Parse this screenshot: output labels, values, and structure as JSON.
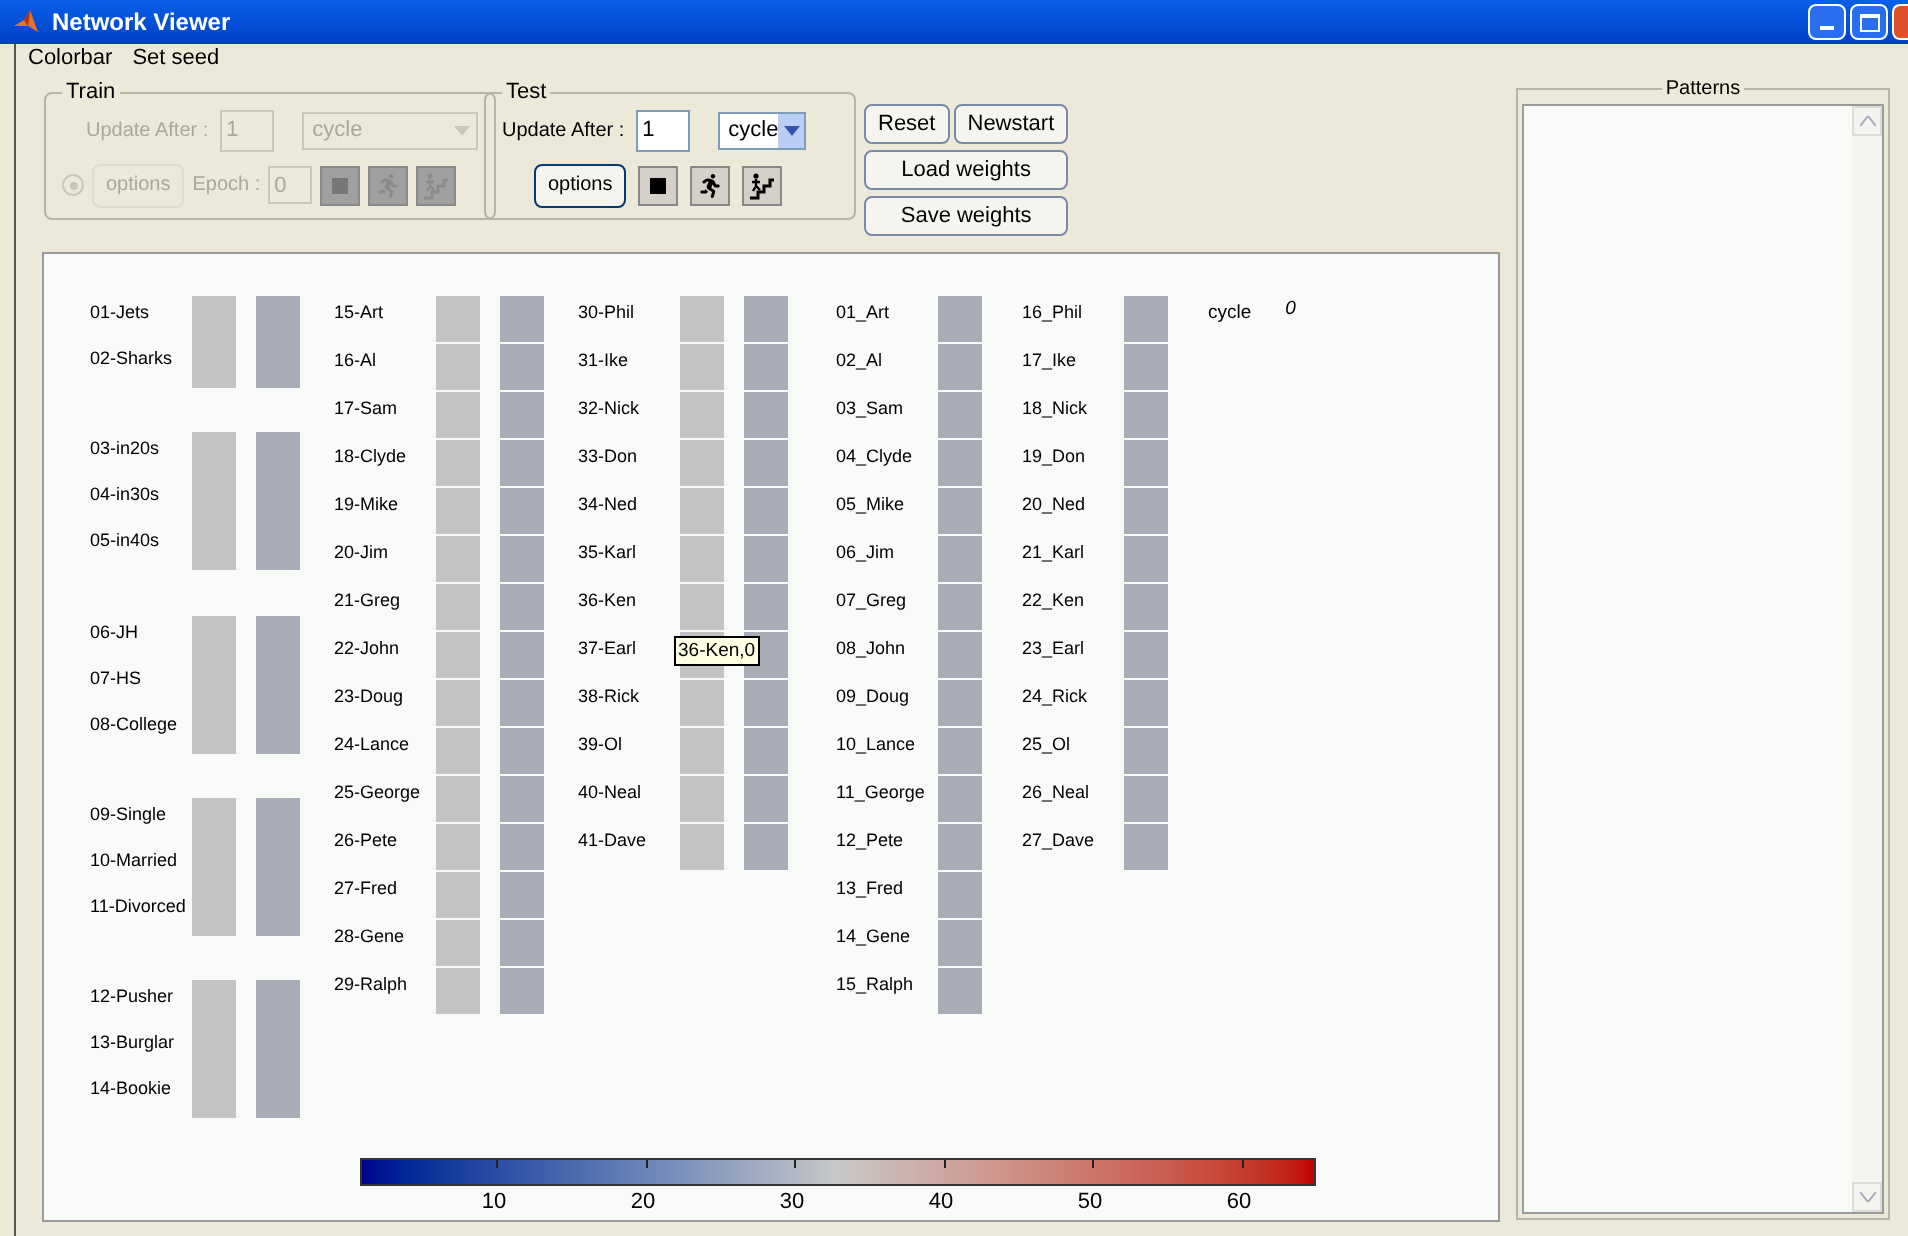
{
  "window": {
    "title": "Network Viewer"
  },
  "menu": [
    "Colorbar",
    "Set seed"
  ],
  "train": {
    "title": "Train",
    "disabled": true,
    "update_label": "Update After :",
    "update_value": "1",
    "mode": "cycle",
    "options": "options",
    "epoch_label": "Epoch :",
    "epoch_value": "0"
  },
  "test": {
    "title": "Test",
    "disabled": false,
    "update_label": "Update After :",
    "update_value": "1",
    "mode": "cycle",
    "options": "options"
  },
  "buttons": [
    "Reset",
    "Newstart",
    "Load weights",
    "Save weights"
  ],
  "network": {
    "columns": [
      {
        "cells": [
          {
            "color": "#c3c3c3"
          },
          {
            "color": "#a9acb7"
          }
        ],
        "units": [
          {
            "kind": "unit",
            "label": "01-Jets"
          },
          {
            "kind": "unit",
            "label": "02-Sharks"
          },
          {
            "kind": "gap"
          },
          {
            "kind": "unit",
            "label": "03-in20s"
          },
          {
            "kind": "unit",
            "label": "04-in30s"
          },
          {
            "kind": "unit",
            "label": "05-in40s"
          },
          {
            "kind": "gap"
          },
          {
            "kind": "unit",
            "label": "06-JH"
          },
          {
            "kind": "unit",
            "label": "07-HS"
          },
          {
            "kind": "unit",
            "label": "08-College"
          },
          {
            "kind": "gap"
          },
          {
            "kind": "unit",
            "label": "09-Single"
          },
          {
            "kind": "unit",
            "label": "10-Married"
          },
          {
            "kind": "unit",
            "label": "11-Divorced"
          },
          {
            "kind": "gap"
          },
          {
            "kind": "unit",
            "label": "12-Pusher"
          },
          {
            "kind": "unit",
            "label": "13-Burglar"
          },
          {
            "kind": "unit",
            "label": "14-Bookie"
          }
        ]
      },
      {
        "cells": [
          {
            "color": "#c3c3c3"
          },
          {
            "color": "#a9acb7"
          }
        ],
        "units": [
          {
            "kind": "unit",
            "label": "15-Art"
          },
          {
            "kind": "unit",
            "label": "16-Al"
          },
          {
            "kind": "unit",
            "label": "17-Sam"
          },
          {
            "kind": "unit",
            "label": "18-Clyde"
          },
          {
            "kind": "unit",
            "label": "19-Mike"
          },
          {
            "kind": "unit",
            "label": "20-Jim"
          },
          {
            "kind": "unit",
            "label": "21-Greg"
          },
          {
            "kind": "unit",
            "label": "22-John"
          },
          {
            "kind": "unit",
            "label": "23-Doug"
          },
          {
            "kind": "unit",
            "label": "24-Lance"
          },
          {
            "kind": "unit",
            "label": "25-George"
          },
          {
            "kind": "unit",
            "label": "26-Pete"
          },
          {
            "kind": "unit",
            "label": "27-Fred"
          },
          {
            "kind": "unit",
            "label": "28-Gene"
          },
          {
            "kind": "unit",
            "label": "29-Ralph"
          }
        ]
      },
      {
        "cells": [
          {
            "color": "#c3c3c3"
          },
          {
            "color": "#a9acb7"
          }
        ],
        "units": [
          {
            "kind": "unit",
            "label": "30-Phil"
          },
          {
            "kind": "unit",
            "label": "31-Ike"
          },
          {
            "kind": "unit",
            "label": "32-Nick"
          },
          {
            "kind": "unit",
            "label": "33-Don"
          },
          {
            "kind": "unit",
            "label": "34-Ned"
          },
          {
            "kind": "unit",
            "label": "35-Karl"
          },
          {
            "kind": "unit",
            "label": "36-Ken"
          },
          {
            "kind": "unit",
            "label": "37-Earl"
          },
          {
            "kind": "unit",
            "label": "38-Rick"
          },
          {
            "kind": "unit",
            "label": "39-Ol"
          },
          {
            "kind": "unit",
            "label": "40-Neal"
          },
          {
            "kind": "unit",
            "label": "41-Dave"
          }
        ]
      },
      {
        "cells": [
          {
            "color": "#a9acb7"
          }
        ],
        "units": [
          {
            "kind": "unit",
            "label": "01_Art"
          },
          {
            "kind": "unit",
            "label": "02_Al"
          },
          {
            "kind": "unit",
            "label": "03_Sam"
          },
          {
            "kind": "unit",
            "label": "04_Clyde"
          },
          {
            "kind": "unit",
            "label": "05_Mike"
          },
          {
            "kind": "unit",
            "label": "06_Jim"
          },
          {
            "kind": "unit",
            "label": "07_Greg"
          },
          {
            "kind": "unit",
            "label": "08_John"
          },
          {
            "kind": "unit",
            "label": "09_Doug"
          },
          {
            "kind": "unit",
            "label": "10_Lance"
          },
          {
            "kind": "unit",
            "label": "11_George"
          },
          {
            "kind": "unit",
            "label": "12_Pete"
          },
          {
            "kind": "unit",
            "label": "13_Fred"
          },
          {
            "kind": "unit",
            "label": "14_Gene"
          },
          {
            "kind": "unit",
            "label": "15_Ralph"
          }
        ]
      },
      {
        "cells": [
          {
            "color": "#a9acb7"
          }
        ],
        "units": [
          {
            "kind": "unit",
            "label": "16_Phil"
          },
          {
            "kind": "unit",
            "label": "17_Ike"
          },
          {
            "kind": "unit",
            "label": "18_Nick"
          },
          {
            "kind": "unit",
            "label": "19_Don"
          },
          {
            "kind": "unit",
            "label": "20_Ned"
          },
          {
            "kind": "unit",
            "label": "21_Karl"
          },
          {
            "kind": "unit",
            "label": "22_Ken"
          },
          {
            "kind": "unit",
            "label": "23_Earl"
          },
          {
            "kind": "unit",
            "label": "24_Rick"
          },
          {
            "kind": "unit",
            "label": "25_Ol"
          },
          {
            "kind": "unit",
            "label": "26_Neal"
          },
          {
            "kind": "unit",
            "label": "27_Dave"
          }
        ]
      }
    ],
    "cycle": {
      "label": "cycle",
      "value": "0"
    },
    "tooltip": "36-Ken,0",
    "colorbar": {
      "ticks": [
        "10",
        "20",
        "30",
        "40",
        "50",
        "60"
      ]
    }
  },
  "patterns": {
    "title": "Patterns"
  }
}
